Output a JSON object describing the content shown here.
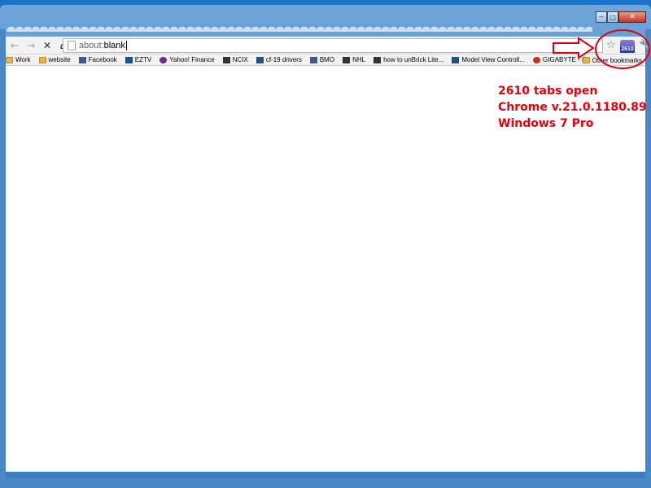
{
  "window": {
    "minimize": "‒",
    "maximize": "□",
    "close": "✕"
  },
  "toolbar": {
    "back_icon": "←",
    "forward_icon": "→",
    "stop_icon": "✕",
    "home_icon": "⌂",
    "url_scheme": "about:",
    "url_host": "blank",
    "star_icon": "☆",
    "extension_badge": "2610",
    "wrench_icon": "🔧"
  },
  "bookmarks": [
    {
      "label": "Work",
      "icon": "folder"
    },
    {
      "label": "website",
      "icon": "folder"
    },
    {
      "label": "Facebook",
      "icon": "blue"
    },
    {
      "label": "EZTV",
      "icon": "nav"
    },
    {
      "label": "Yahoo! Finance",
      "icon": "purple"
    },
    {
      "label": "NCIX",
      "icon": "dark"
    },
    {
      "label": "cf-19 drivers",
      "icon": "nav"
    },
    {
      "label": "BMO",
      "icon": "blue"
    },
    {
      "label": "NHL",
      "icon": "dark"
    },
    {
      "label": "how to unBrick Lite...",
      "icon": "dark"
    },
    {
      "label": "Model View Controll...",
      "icon": "nav"
    },
    {
      "label": "GIGABYTE - Mother...",
      "icon": "red"
    }
  ],
  "other_bookmarks": "Other bookmarks",
  "annotation": {
    "line1": "2610 tabs open",
    "line2": "Chrome v.21.0.1180.89",
    "line3": "Windows 7 Pro"
  },
  "colors": {
    "annotation": "#e8000b"
  }
}
